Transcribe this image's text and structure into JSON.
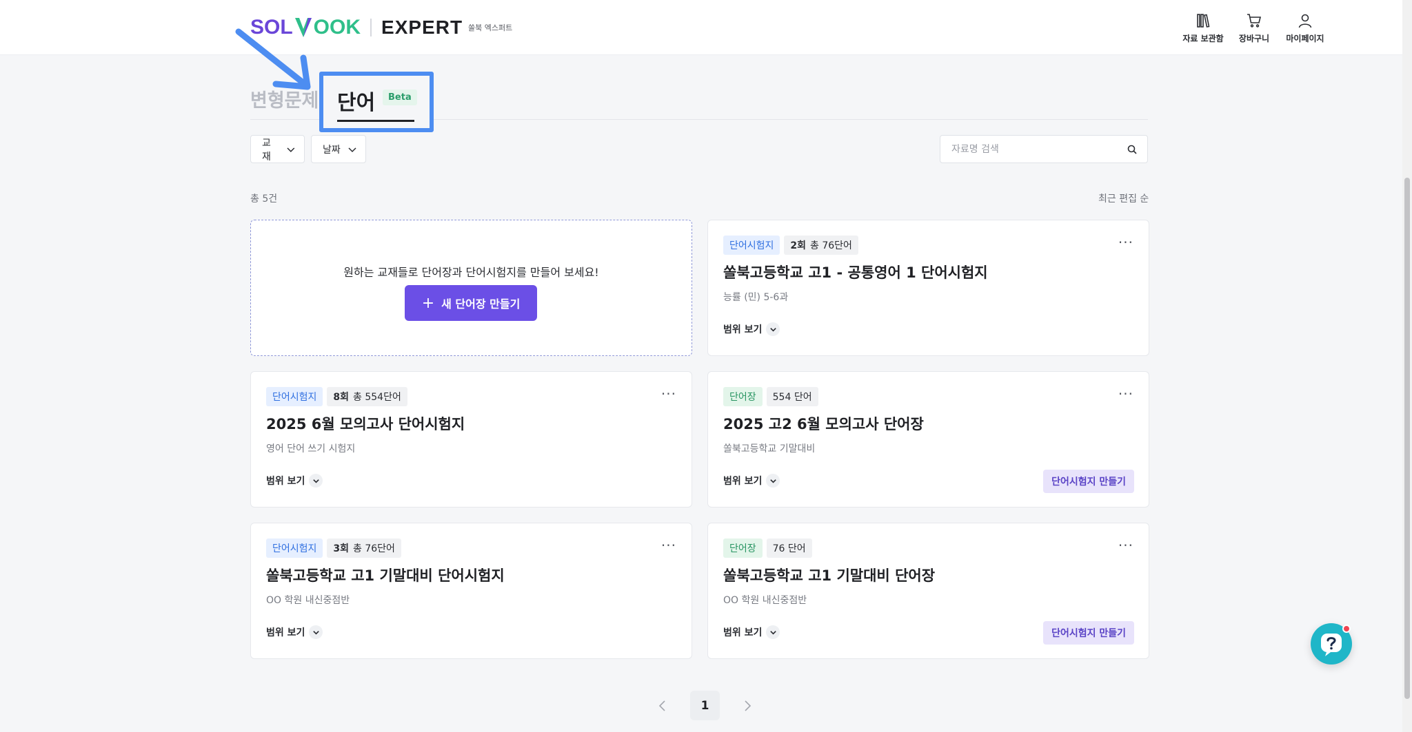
{
  "header": {
    "logo_left": "SOL",
    "logo_right": "OOK",
    "logo_expert": "EXPERT",
    "logo_sub": "쏠북 엑스퍼트",
    "actions": [
      {
        "label": "자료 보관함",
        "icon": "books-icon"
      },
      {
        "label": "장바구니",
        "icon": "cart-icon"
      },
      {
        "label": "마이페이지",
        "icon": "user-icon"
      }
    ]
  },
  "tabs": {
    "transform": "변형문제",
    "word": "단어",
    "beta": "Beta"
  },
  "filters": {
    "textbook": "교재",
    "date": "날짜",
    "search_placeholder": "자료명 검색"
  },
  "list": {
    "count": "총 5건",
    "sort": "최근 편집 순"
  },
  "new_card": {
    "text": "원하는 교재들로 단어장과 단어시험지를 만들어 보세요!",
    "button": "새 단어장 만들기"
  },
  "cards": [
    {
      "type": "단어시험지",
      "kind": "test",
      "meta_bold": "2회",
      "meta": "총 76단어",
      "title": "쏠북고등학교 고1 - 공통영어 1 단어시험지",
      "subtitle": "능률 (민) 5-6과",
      "range": "범위 보기"
    },
    {
      "type": "단어시험지",
      "kind": "test",
      "meta_bold": "8회",
      "meta": "총 554단어",
      "title": "2025 6월 모의고사 단어시험지",
      "subtitle": "영어 단어 쓰기 시험지",
      "range": "범위 보기"
    },
    {
      "type": "단어장",
      "kind": "book",
      "meta_bold": "",
      "meta": "554 단어",
      "title": "2025 고2 6월 모의고사 단어장",
      "subtitle": "쏠북고등학교 기말대비",
      "range": "범위 보기",
      "action": "단어시험지 만들기"
    },
    {
      "type": "단어시험지",
      "kind": "test",
      "meta_bold": "3회",
      "meta": "총 76단어",
      "title": "쏠북고등학교 고1 기말대비 단어시험지",
      "subtitle": "OO 학원 내신중점반",
      "range": "범위 보기"
    },
    {
      "type": "단어장",
      "kind": "book",
      "meta_bold": "",
      "meta": "76 단어",
      "title": "쏠북고등학교 고1 기말대비 단어장",
      "subtitle": "OO 학원 내신중점반",
      "range": "범위 보기",
      "action": "단어시험지 만들기"
    }
  ],
  "more_label": "···",
  "pagination": {
    "current": "1"
  },
  "colors": {
    "primary": "#6b4fe6",
    "annotation": "#4d8df1",
    "test_badge": "#2f6fe0",
    "book_badge": "#279461",
    "help": "#1fb6c8"
  }
}
